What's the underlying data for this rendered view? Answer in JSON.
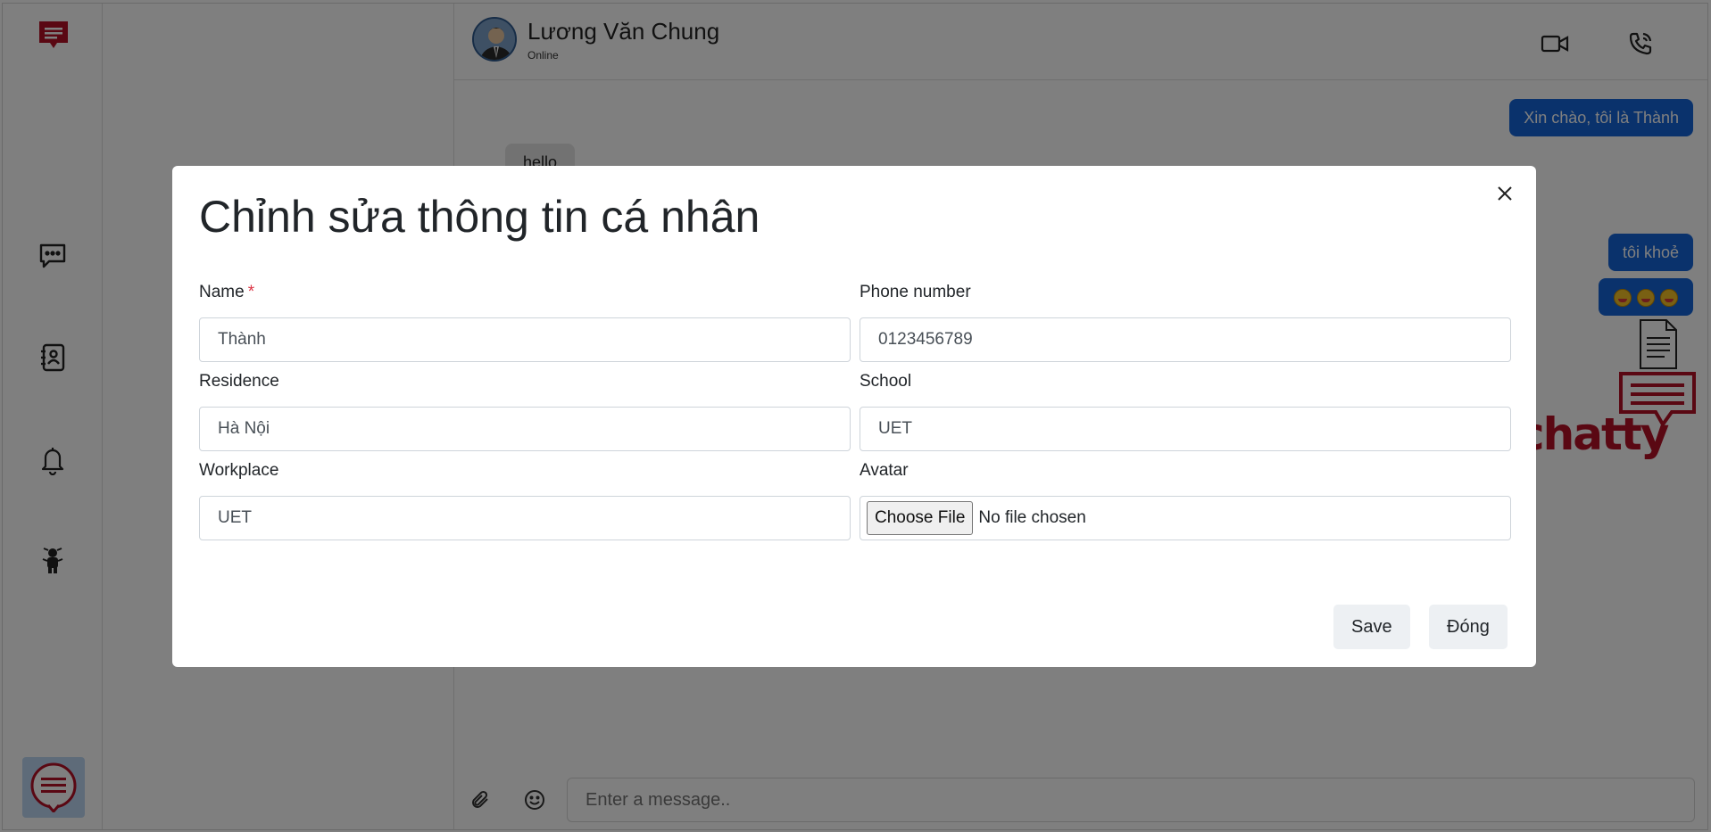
{
  "app": {
    "rail_icons": [
      "logo-icon",
      "chat-icon",
      "contacts-icon",
      "bell-icon",
      "bug-icon",
      "profile-logo-icon"
    ]
  },
  "chat": {
    "contact_name": "Lương Văn Chung",
    "contact_status": "Online",
    "messages": [
      {
        "dir": "out",
        "text": "Xin chào, tôi là Thành"
      },
      {
        "dir": "in",
        "text": "hello"
      },
      {
        "dir": "out",
        "text": "tôi khoẻ"
      },
      {
        "dir": "out",
        "emoji": [
          "smiley-tongue-icon",
          "smiley-tongue-icon",
          "smiley-tongue-icon"
        ]
      },
      {
        "dir": "out",
        "attachment": "document-icon"
      },
      {
        "dir": "out",
        "sticker": "chatty"
      }
    ],
    "composer_placeholder": "Enter a message.."
  },
  "modal": {
    "title": "Chỉnh sửa thông tin cá nhân",
    "fields": {
      "name": {
        "label": "Name",
        "required_mark": "*",
        "value": "Thành"
      },
      "phone": {
        "label": "Phone number",
        "value": "0123456789"
      },
      "residence": {
        "label": "Residence",
        "value": "Hà Nội"
      },
      "school": {
        "label": "School",
        "value": "UET"
      },
      "workplace": {
        "label": "Workplace",
        "value": "UET"
      },
      "avatar": {
        "label": "Avatar",
        "button": "Choose File",
        "status": "No file chosen"
      }
    },
    "save_label": "Save",
    "close_label": "Đóng"
  },
  "colors": {
    "brand_red": "#b51126",
    "bubble_blue": "#1565d8",
    "backdrop": "rgba(0,0,0,0.5)"
  }
}
